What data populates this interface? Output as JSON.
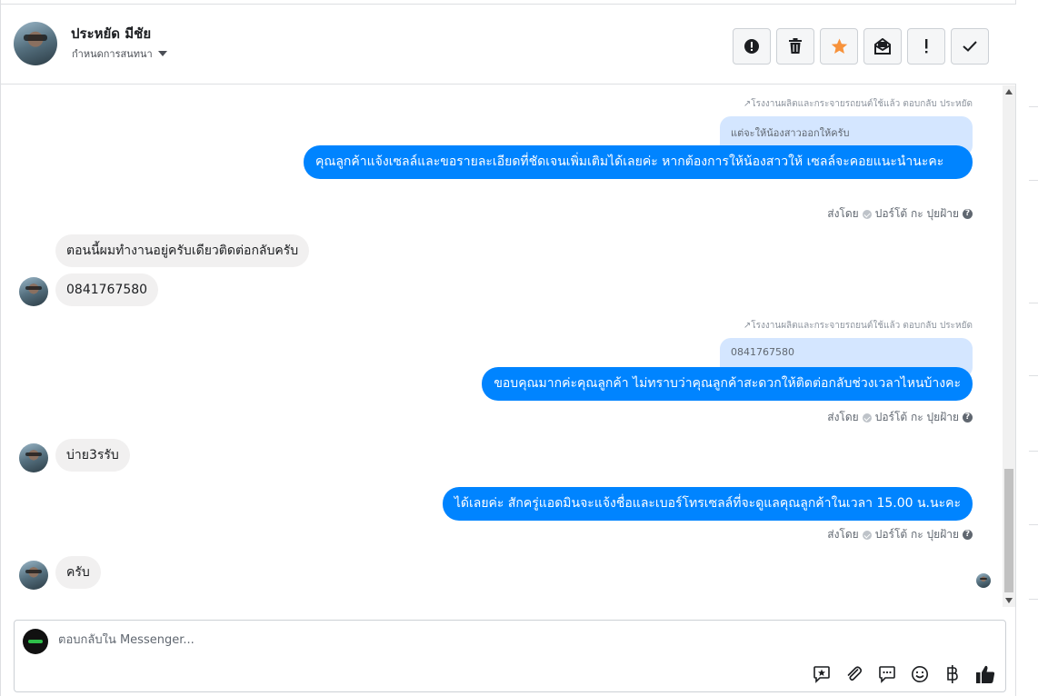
{
  "header": {
    "contact_name": "ประหยัด มีชัย",
    "assign_label": "กำหนดการสนทนา",
    "actions": [
      {
        "name": "spam",
        "icon": "alert-circle-icon"
      },
      {
        "name": "delete",
        "icon": "trash-icon"
      },
      {
        "name": "star",
        "icon": "star-icon",
        "color": "#f7923b"
      },
      {
        "name": "mark-unread",
        "icon": "envelope-icon"
      },
      {
        "name": "important",
        "icon": "exclamation-icon"
      },
      {
        "name": "done",
        "icon": "check-icon"
      }
    ]
  },
  "conversation": {
    "reply1": {
      "note": "โรงงานผลิตและกระจายรถยนต์ใช้แล้ว ตอบกลับ ประหยัด",
      "quoted": "แต่จะให้น้องสาวออกให้ครับ",
      "message": "คุณลูกค้าแจ้งเซลล์และขอรายละเอียดที่ชัดเจนเพิ่มเติมได้เลยค่ะ หากต้องการให้น้องสาวให้ เซลล์จะคอยแนะนำนะคะ",
      "sent_by": "ส่งโดย",
      "agent": "ปอร์โต้ กะ ปุยฝ้าย"
    },
    "incoming1": "ตอนนี้ผมทำงานอยู่ครับเดียวติดต่อกลับครับ",
    "incoming2": "0841767580",
    "reply2": {
      "note": "โรงงานผลิตและกระจายรถยนต์ใช้แล้ว ตอบกลับ ประหยัด",
      "quoted": "0841767580",
      "message": "ขอบคุณมากค่ะคุณลูกค้า ไม่ทราบว่าคุณลูกค้าสะดวกให้ติดต่อกลับช่วงเวลาไหนบ้างคะ",
      "sent_by": "ส่งโดย",
      "agent": "ปอร์โต้ กะ ปุยฝ้าย"
    },
    "incoming3": "บ่าย3รรับ",
    "reply3": {
      "message": "ได้เลยค่ะ สักครู่แอดมินจะแจ้งชื่อและเบอร์โทรเซลล์ที่จะดูแลคุณลูกค้าในเวลา 15.00 น.นะคะ",
      "sent_by": "ส่งโดย",
      "agent": "ปอร์โต้ กะ ปุยฝ้าย"
    },
    "incoming4": "ครับ"
  },
  "composer": {
    "placeholder": "ตอบกลับใน Messenger...",
    "tools": [
      "saved-reply-icon",
      "attachment-icon",
      "chat-bubble-icon",
      "emoji-icon",
      "baht-icon",
      "thumbs-up-icon"
    ]
  },
  "colors": {
    "outgoing_bubble": "#0084ff",
    "quoted_bubble": "#d4e6ff",
    "incoming_bubble": "#f1f0f0",
    "star": "#f7923b"
  }
}
